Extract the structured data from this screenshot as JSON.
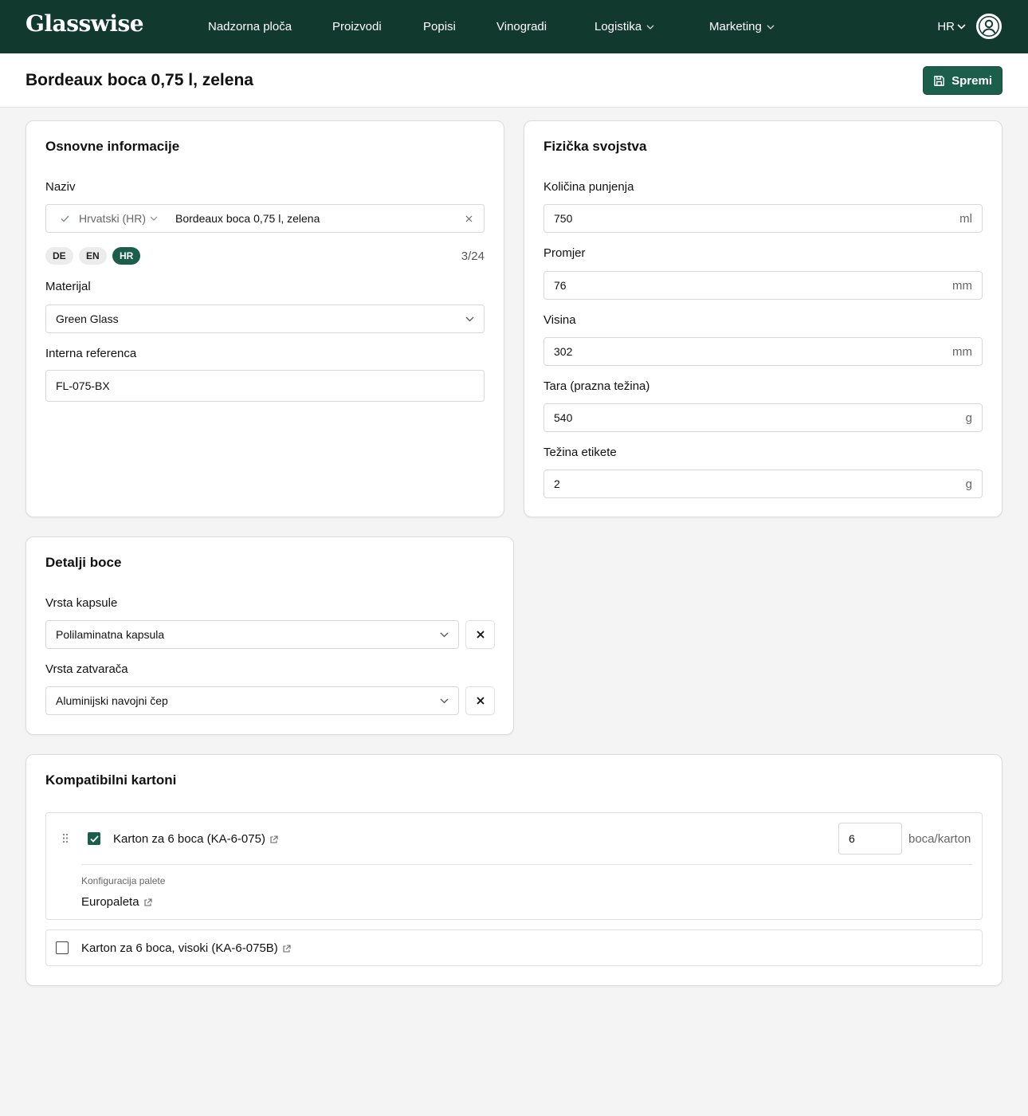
{
  "app": {
    "logo": "Glasswise"
  },
  "nav": {
    "items": [
      {
        "label": "Nadzorna ploča"
      },
      {
        "label": "Proizvodi"
      },
      {
        "label": "Popisi"
      },
      {
        "label": "Vinogradi"
      },
      {
        "label": "Logistika"
      },
      {
        "label": "Marketing"
      }
    ],
    "language": "HR",
    "avatar_icon": "user-circle-icon"
  },
  "header": {
    "title": "Bordeaux boca 0,75 l, zelena",
    "save_label": "Spremi"
  },
  "basic": {
    "title": "Osnovne informacije",
    "name_label": "Naziv",
    "name_lang": "Hrvatski (HR)",
    "name_value": "Bordeaux boca 0,75 l, zelena",
    "lang_pills": [
      "DE",
      "EN",
      "HR"
    ],
    "active_lang": "HR",
    "counter": "3/24",
    "material_label": "Materijal",
    "material_value": "Green Glass",
    "ref_label": "Interna referenca",
    "ref_value": "FL-075-BX"
  },
  "physical": {
    "title": "Fizička svojstva",
    "fields": [
      {
        "label": "Količina punjenja",
        "value": "750",
        "unit": "ml"
      },
      {
        "label": "Promjer",
        "value": "76",
        "unit": "mm"
      },
      {
        "label": "Visina",
        "value": "302",
        "unit": "mm"
      },
      {
        "label": "Tara (prazna težina)",
        "value": "540",
        "unit": "g"
      },
      {
        "label": "Težina etikete",
        "value": "2",
        "unit": "g"
      }
    ]
  },
  "bottle": {
    "title": "Detalji boce",
    "capsule_label": "Vrsta kapsule",
    "capsule_value": "Polilaminatna kapsula",
    "closure_label": "Vrsta zatvarača",
    "closure_value": "Aluminijski navojni čep"
  },
  "cartons": {
    "title": "Kompatibilni kartoni",
    "items": [
      {
        "name": "Karton za 6 boca (KA-6-075)",
        "checked": true,
        "qty": "6",
        "unit": "boca/karton",
        "pallet_label": "Konfiguracija palete",
        "pallet_value": "Europaleta"
      },
      {
        "name": "Karton za 6 boca, visoki (KA-6-075B)",
        "checked": false
      }
    ]
  },
  "colors": {
    "nav": "#11392e",
    "accent": "#1b5e4a",
    "background": "#f4f4f4"
  }
}
